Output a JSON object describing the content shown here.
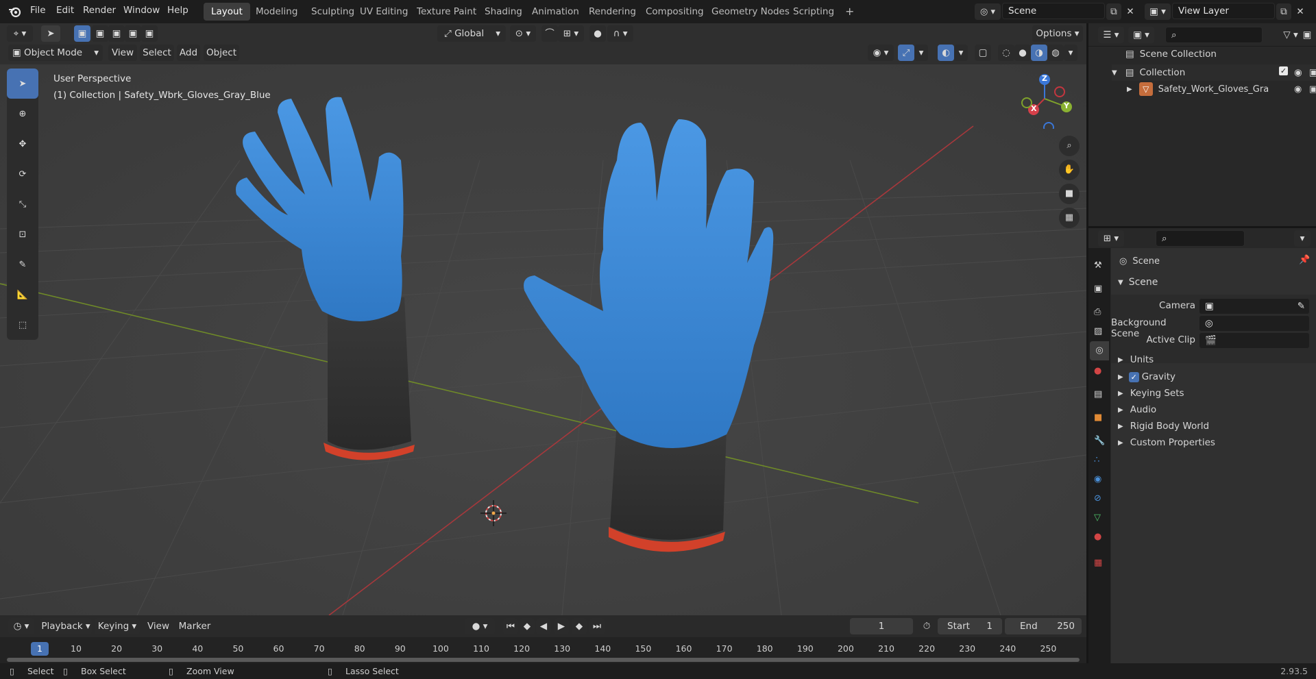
{
  "topbar": {
    "menus": [
      "File",
      "Edit",
      "Render",
      "Window",
      "Help"
    ],
    "workspaces": [
      "Layout",
      "Modeling",
      "Sculpting",
      "UV Editing",
      "Texture Paint",
      "Shading",
      "Animation",
      "Rendering",
      "Compositing",
      "Geometry Nodes",
      "Scripting"
    ],
    "active_workspace": "Layout",
    "add_tab": "+",
    "scene_field": "Scene",
    "viewlayer_field": "View Layer"
  },
  "viewport_header": {
    "transform_orientation": "Global",
    "options_label": "Options",
    "mode": "Object Mode",
    "menus": [
      "View",
      "Select",
      "Add",
      "Object"
    ]
  },
  "viewport": {
    "perspective_label": "User Perspective",
    "collection_label": "(1) Collection | Safety_Wbrk_Gloves_Gray_Blue",
    "gizmo": {
      "x": "X",
      "y": "Y",
      "z": "Z"
    }
  },
  "outliner": {
    "root": "Scene Collection",
    "collection": "Collection",
    "object": "Safety_Work_Gloves_Gra"
  },
  "properties": {
    "context": "Scene",
    "panel_title": "Scene",
    "fields": [
      {
        "label": "Camera"
      },
      {
        "label": "Background Scene"
      },
      {
        "label": "Active Clip"
      }
    ],
    "sections": [
      "Units",
      "Gravity",
      "Keying Sets",
      "Audio",
      "Rigid Body World",
      "Custom Properties"
    ],
    "gravity_checked": true
  },
  "timeline": {
    "menus": [
      "Playback",
      "Keying",
      "View",
      "Marker"
    ],
    "current_frame": "1",
    "start_label": "Start",
    "start_value": "1",
    "end_label": "End",
    "end_value": "250",
    "ticks": [
      "1",
      "10",
      "20",
      "30",
      "40",
      "50",
      "60",
      "70",
      "80",
      "90",
      "100",
      "110",
      "120",
      "130",
      "140",
      "150",
      "160",
      "170",
      "180",
      "190",
      "200",
      "210",
      "220",
      "230",
      "240",
      "250"
    ]
  },
  "statusbar": {
    "select": "Select",
    "box_select": "Box Select",
    "zoom_view": "Zoom View",
    "lasso_select": "Lasso Select",
    "version": "2.93.5"
  },
  "colors": {
    "accent": "#4772b3",
    "glove_blue": "#3f8ad6",
    "x_axis": "#b5383f",
    "y_axis": "#7fa22b",
    "z_axis": "#3a77d8"
  }
}
